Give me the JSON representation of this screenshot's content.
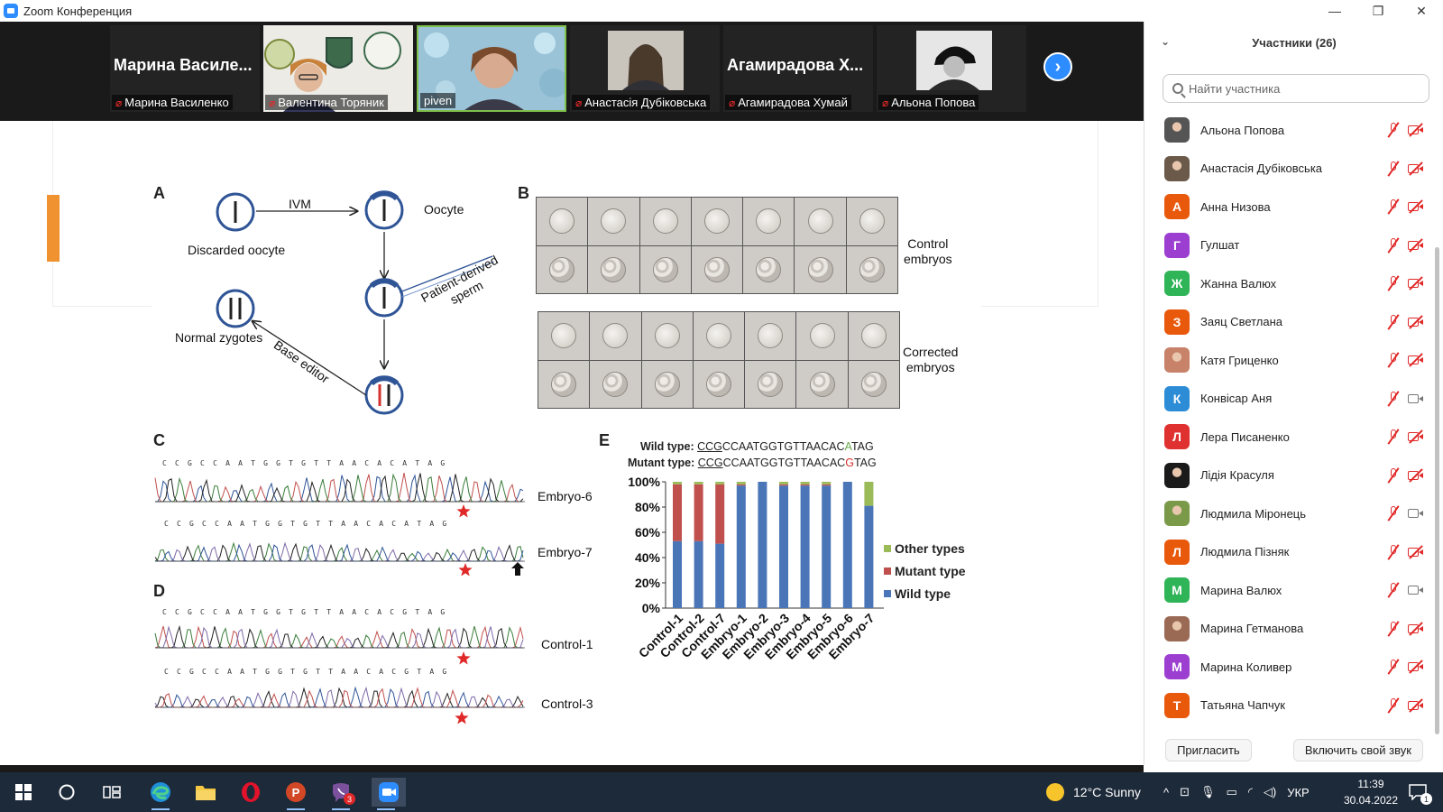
{
  "window": {
    "title": "Zoom Конференция",
    "controls": {
      "minimize": "—",
      "restore": "❐",
      "close": "✕"
    }
  },
  "video_strip": {
    "tiles": [
      {
        "big_name": "Марина Василе...",
        "label": "Марина Василенко",
        "muted": true
      },
      {
        "big_name": "",
        "label": "Валентина Торяник",
        "muted": true
      },
      {
        "big_name": "",
        "label": "piven",
        "muted": false
      },
      {
        "big_name": "",
        "label": "Анастасія Дубіковська",
        "muted": true
      },
      {
        "big_name": "Агамирадова Х...",
        "label": "Агамирадова Хумай",
        "muted": true
      },
      {
        "big_name": "",
        "label": "Альона Попова",
        "muted": true
      }
    ],
    "next_label": "›"
  },
  "slide": {
    "panel_a": {
      "label": "A",
      "ivm": "IVM",
      "oocyte": "Oocyte",
      "discarded": "Discarded oocyte",
      "normal_zygotes": "Normal zygotes",
      "base_editor": "Base editor",
      "sperm": "Patient-derived sperm",
      "sperm_line1": "Patient-derived",
      "sperm_line2": "sperm"
    },
    "panel_b": {
      "label": "B",
      "control": [
        "Control",
        "embryos"
      ],
      "corrected": [
        "Corrected",
        "embryos"
      ]
    },
    "panel_c": {
      "label": "C",
      "seq1": "CCGCCAATGGTGTTAACACATAG",
      "seq2": "CCGCCAATGGTGTTAACACATAG",
      "traces": [
        "Embryo-6",
        "Embryo-7"
      ]
    },
    "panel_d": {
      "label": "D",
      "seq1": "CCGCCAATGGTGTTAACACGTAG",
      "seq2": "CCGCCAATGGTGTTAACACGTAG",
      "traces": [
        "Control-1",
        "Control-3"
      ]
    },
    "panel_e": {
      "label": "E",
      "wild_prefix": "Wild type: ",
      "mutant_prefix": "Mutant type: ",
      "wild_pam": "CCG",
      "wild_mid": "CCAATGGTGTTAACAC",
      "wild_snp": "A",
      "wild_tail": "TAG",
      "mutant_pam": "CCG",
      "mutant_mid": "CCAATGGTGTTAACAC",
      "mutant_snp": "G",
      "mutant_tail": "TAG"
    }
  },
  "chart_data": {
    "type": "bar",
    "stacked": true,
    "categories": [
      "Control-1",
      "Control-2",
      "Control-7",
      "Embryo-1",
      "Embryo-2",
      "Embryo-3",
      "Embryo-4",
      "Embryo-5",
      "Embryo-6",
      "Embryo-7"
    ],
    "series": [
      {
        "name": "Wild type",
        "color": "#4a76b8",
        "values": [
          53,
          53,
          51,
          97,
          100,
          97,
          97,
          97,
          100,
          81
        ]
      },
      {
        "name": "Mutant type",
        "color": "#c0504d",
        "values": [
          45,
          45,
          47,
          1,
          0,
          1,
          1,
          1,
          0,
          0
        ]
      },
      {
        "name": "Other types",
        "color": "#9bbb59",
        "values": [
          2,
          2,
          2,
          2,
          0,
          2,
          2,
          2,
          0,
          19
        ]
      }
    ],
    "yticks": [
      "0%",
      "20%",
      "40%",
      "60%",
      "80%",
      "100%"
    ],
    "ylim": [
      0,
      100
    ],
    "legend": "right"
  },
  "participants": {
    "header": "Участники (26)",
    "search_placeholder": "Найти участника",
    "list": [
      {
        "name": "Альона Попова",
        "initial": "",
        "color": "#555555",
        "photo": true,
        "video_on": false
      },
      {
        "name": "Анастасія Дубіковська",
        "initial": "",
        "color": "#6b5a4a",
        "photo": true,
        "video_on": false
      },
      {
        "name": "Анна Низова",
        "initial": "А",
        "color": "#e8590c",
        "photo": false,
        "video_on": false
      },
      {
        "name": "Гулшат",
        "initial": "Г",
        "color": "#9c3fd1",
        "photo": false,
        "video_on": false
      },
      {
        "name": "Жанна Валюх",
        "initial": "Ж",
        "color": "#2fb457",
        "photo": false,
        "video_on": false
      },
      {
        "name": "Заяц Светлана",
        "initial": "З",
        "color": "#e8590c",
        "photo": false,
        "video_on": false
      },
      {
        "name": "Катя Гриценко",
        "initial": "",
        "color": "#c8826a",
        "photo": true,
        "video_on": false
      },
      {
        "name": "Конвісар Аня",
        "initial": "К",
        "color": "#2d8cd6",
        "photo": false,
        "video_on": true
      },
      {
        "name": "Лера Писаненко",
        "initial": "Л",
        "color": "#e03131",
        "photo": false,
        "video_on": false
      },
      {
        "name": "Лідія Красуля",
        "initial": "",
        "color": "#1a1a1a",
        "photo": true,
        "video_on": false
      },
      {
        "name": "Людмила Міронець",
        "initial": "",
        "color": "#7a9a4a",
        "photo": true,
        "video_on": true
      },
      {
        "name": "Людмила Пізняк",
        "initial": "Л",
        "color": "#e8590c",
        "photo": false,
        "video_on": false
      },
      {
        "name": "Марина Валюх",
        "initial": "М",
        "color": "#2fb457",
        "photo": false,
        "video_on": true
      },
      {
        "name": "Марина Гетманова",
        "initial": "",
        "color": "#9a6a55",
        "photo": true,
        "video_on": false
      },
      {
        "name": "Марина Коливер",
        "initial": "М",
        "color": "#9c3fd1",
        "photo": false,
        "video_on": false
      },
      {
        "name": "Татьяна Чапчук",
        "initial": "Т",
        "color": "#e8590c",
        "photo": false,
        "video_on": false
      }
    ],
    "invite": "Пригласить",
    "unmute": "Включить свой звук"
  },
  "taskbar": {
    "weather": "12°C  Sunny",
    "lang": "УКР",
    "time": "11:39",
    "date": "30.04.2022",
    "viber_badge": "3",
    "notif_badge": "1"
  }
}
